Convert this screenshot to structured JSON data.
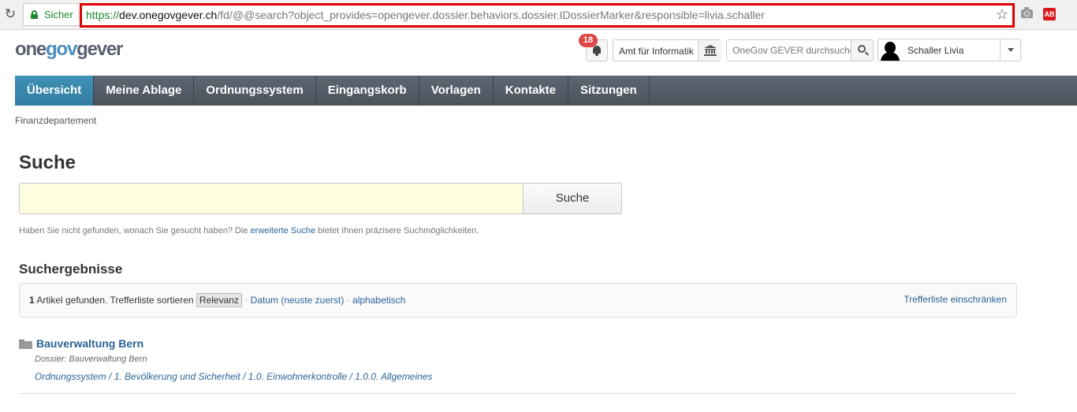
{
  "browser": {
    "secure_label": "Sicher",
    "url_scheme": "https://",
    "url_host": "dev.onegovgever.ch",
    "url_path": "/fd/@@search?object_provides=opengever.dossier.behaviors.dossier.IDossierMarker&responsible=livia.schaller",
    "extension_label": "AB"
  },
  "header": {
    "logo_part1": "one",
    "logo_part2": "gov",
    "logo_part3": "gever",
    "notification_count": "18",
    "org_unit": "Amt für Informatik",
    "search_placeholder": "OneGov GEVER durchsuchen",
    "user_name": "Schaller Livia"
  },
  "nav": {
    "items": [
      "Übersicht",
      "Meine Ablage",
      "Ordnungssystem",
      "Eingangskorb",
      "Vorlagen",
      "Kontakte",
      "Sitzungen"
    ]
  },
  "breadcrumb": "Finanzdepartement",
  "search": {
    "heading": "Suche",
    "query": "",
    "button": "Suche",
    "hint_before": "Haben Sie nicht gefunden, wonach Sie gesucht haben? Die",
    "hint_link": "erweiterte Suche",
    "hint_after": "bietet Ihnen präzisere Suchmöglichkeiten."
  },
  "results": {
    "heading": "Suchergebnisse",
    "count": "1",
    "count_text": "Artikel gefunden. Trefferliste sortieren",
    "sort_relevance": "Relevanz",
    "sort_date": "Datum (neuste zuerst)",
    "sort_alpha": "alphabetisch",
    "separator": "·",
    "filter_link": "Trefferliste einschränken",
    "items": [
      {
        "title": "Bauverwaltung Bern",
        "subtitle": "Dossier: Bauverwaltung Bern",
        "path": "Ordnungssystem / 1. Bevölkerung und Sicherheit / 1.0. Einwohnerkontrolle / 1.0.0. Allgemeines"
      }
    ]
  },
  "colors": {
    "nav_active": "#3a88ad",
    "nav_bg": "#555c66",
    "link": "#2a6496",
    "url_highlight": "#e00000",
    "search_field_bg": "#fefde0",
    "badge": "#e04848"
  }
}
